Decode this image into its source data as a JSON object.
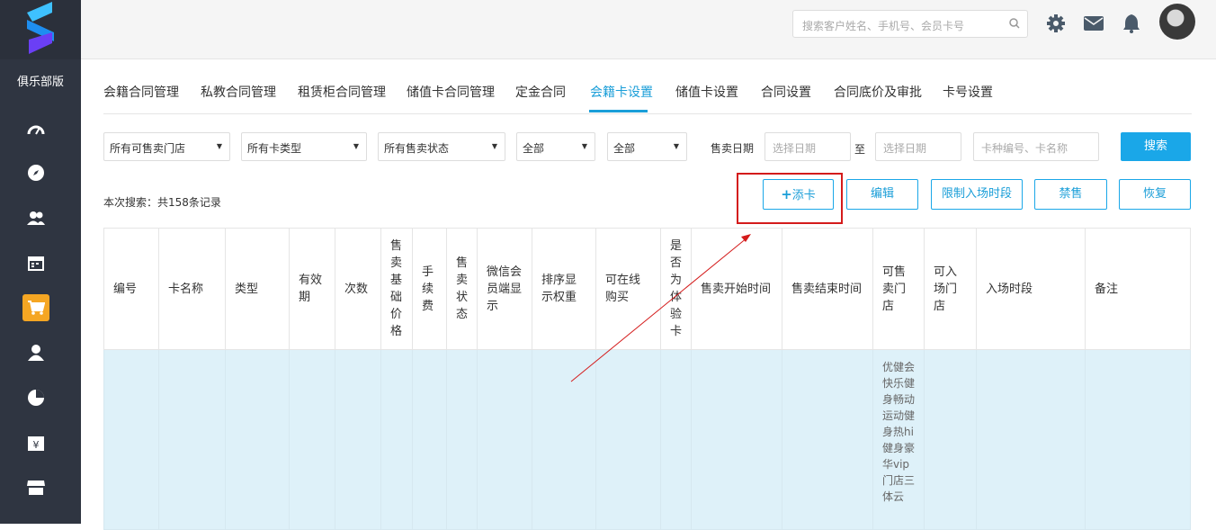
{
  "sidebar": {
    "club_label": "俱乐部版",
    "items": [
      {
        "icon": "dashboard-icon"
      },
      {
        "icon": "compass-icon"
      },
      {
        "icon": "members-icon"
      },
      {
        "icon": "calendar-icon"
      },
      {
        "icon": "shopping-cart-icon",
        "active": true
      },
      {
        "icon": "user-icon"
      },
      {
        "icon": "pie-chart-icon"
      },
      {
        "icon": "yen-icon"
      },
      {
        "icon": "store-icon"
      }
    ]
  },
  "header": {
    "search_placeholder": "搜索客户姓名、手机号、会员卡号"
  },
  "tabs": [
    "会籍合同管理",
    "私教合同管理",
    "租赁柜合同管理",
    "储值卡合同管理",
    "定金合同",
    "会籍卡设置",
    "储值卡设置",
    "合同设置",
    "合同底价及审批",
    "卡号设置"
  ],
  "active_tab": "会籍卡设置",
  "filters": {
    "store": "所有可售卖门店",
    "card_type": "所有卡类型",
    "sale_status": "所有售卖状态",
    "all1": "全部",
    "all2": "全部",
    "sale_date_label": "售卖日期",
    "date_placeholder": "选择日期",
    "to_label": "至",
    "keyword_placeholder": "卡种编号、卡名称",
    "search_button": "搜索"
  },
  "result_count": "本次搜索：共158条记录",
  "actions": {
    "add": "添卡",
    "edit": "编辑",
    "limit": "限制入场时段",
    "ban": "禁售",
    "restore": "恢复"
  },
  "table": {
    "headers": [
      "编号",
      "卡名称",
      "类型",
      "有效期",
      "次数",
      "售卖基础价格",
      "手续费",
      "售卖状态",
      "微信会员端显示",
      "排序显示权重",
      "可在线购买",
      "是否为体验卡",
      "售卖开始时间",
      "售卖结束时间",
      "可售卖门店",
      "可入场门店",
      "入场时段",
      "备注"
    ],
    "row1_stores": "优健会快乐健身畅动运动健身热hi健身豪华vip门店三体云"
  },
  "colors": {
    "accent": "#1a9ed8",
    "sidebar": "#2f3541",
    "highlight": "#d41b1b",
    "active_nav": "#f5a623"
  }
}
